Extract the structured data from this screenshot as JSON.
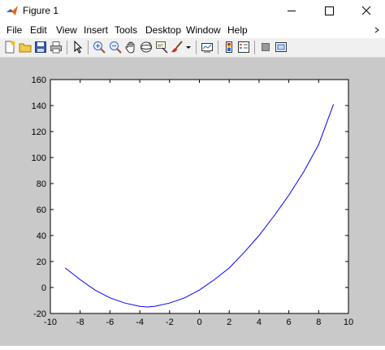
{
  "window": {
    "title": "Figure 1"
  },
  "menu": [
    "File",
    "Edit",
    "View",
    "Insert",
    "Tools",
    "Desktop",
    "Window",
    "Help"
  ],
  "toolbar": {
    "icons": [
      "new-figure-icon",
      "open-file-icon",
      "save-icon",
      "print-icon",
      "edit-plot-arrow-icon",
      "zoom-in-icon",
      "zoom-out-icon",
      "pan-hand-icon",
      "rotate-3d-icon",
      "data-cursor-icon",
      "brush-icon",
      "brush-dropdown-icon",
      "link-plot-icon",
      "insert-colorbar-icon",
      "insert-legend-icon",
      "hide-plot-tools-icon",
      "show-plot-tools-icon"
    ]
  },
  "colors": {
    "line": "#0000ff",
    "figure_bg": "#c9c9c9",
    "axes_bg": "#ffffff"
  },
  "chart_data": {
    "type": "line",
    "title": "",
    "xlabel": "",
    "ylabel": "",
    "xlim": [
      -10,
      10
    ],
    "ylim": [
      -20,
      160
    ],
    "xticks": [
      -10,
      -8,
      -6,
      -4,
      -2,
      0,
      2,
      4,
      6,
      8,
      10
    ],
    "yticks": [
      -20,
      0,
      20,
      40,
      60,
      80,
      100,
      120,
      140,
      160
    ],
    "grid": false,
    "series": [
      {
        "color": "#0000ff",
        "x": [
          -9,
          -8,
          -7,
          -6,
          -5,
          -4,
          -3.5,
          -3,
          -2,
          -1,
          0,
          1,
          2,
          3,
          4,
          5,
          6,
          7,
          8,
          9
        ],
        "y": [
          15,
          6,
          -2,
          -8,
          -12,
          -14.5,
          -15,
          -14.5,
          -12,
          -8,
          -2,
          6,
          15,
          27,
          40,
          55,
          71,
          89,
          110,
          141
        ]
      }
    ]
  }
}
